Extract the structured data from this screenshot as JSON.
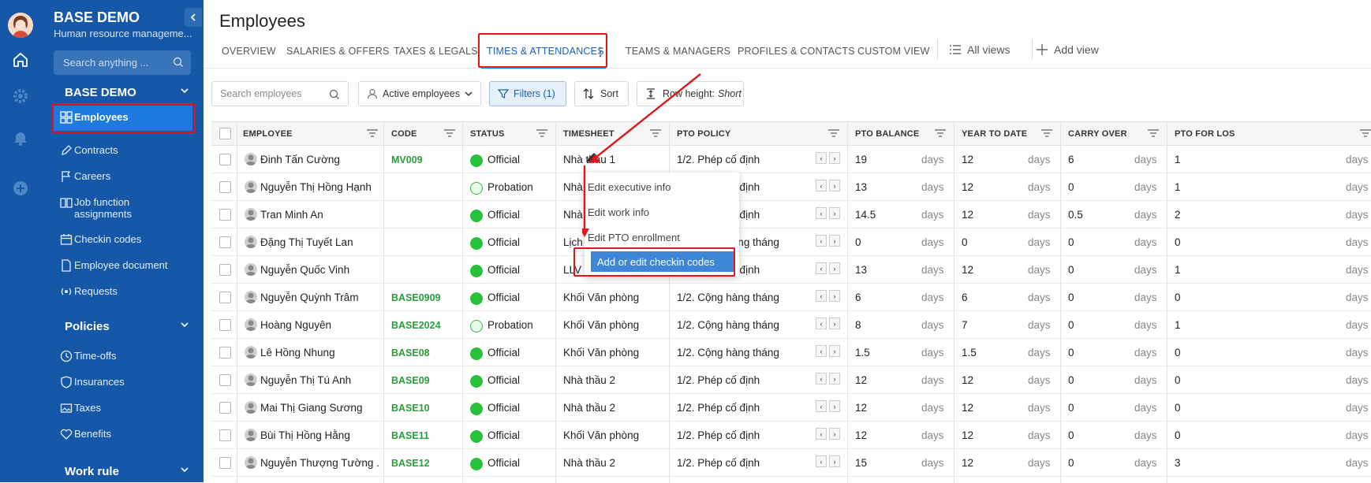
{
  "sidebar": {
    "brand": "BASE DEMO",
    "subtitle": "Human resource manageme...",
    "search_placeholder": "Search anything ...",
    "section1": "BASE DEMO",
    "items": [
      {
        "label": "Employees",
        "icon": "grid-icon"
      },
      {
        "label": "Contracts",
        "icon": "pen-icon"
      },
      {
        "label": "Careers",
        "icon": "flag-icon"
      },
      {
        "label": "Job function assignments",
        "icon": "book-icon"
      },
      {
        "label": "Checkin codes",
        "icon": "calendar-icon"
      },
      {
        "label": "Employee document",
        "icon": "document-icon"
      },
      {
        "label": "Requests",
        "icon": "broadcast-icon"
      }
    ],
    "section2": "Policies",
    "policy_items": [
      {
        "label": "Time-offs",
        "icon": "clock-icon"
      },
      {
        "label": "Insurances",
        "icon": "shield-icon"
      },
      {
        "label": "Taxes",
        "icon": "image-icon"
      },
      {
        "label": "Benefits",
        "icon": "heart-icon"
      }
    ],
    "section3": "Work rule"
  },
  "page": {
    "title": "Employees"
  },
  "tabs": [
    "OVERVIEW",
    "SALARIES & OFFERS",
    "TAXES & LEGALS",
    "TIMES & ATTENDANCES",
    "TEAMS & MANAGERS",
    "PROFILES & CONTACTS",
    "CUSTOM VIEW"
  ],
  "views": {
    "all": "All views",
    "add": "Add view"
  },
  "toolbar": {
    "search_placeholder": "Search employees",
    "active": "Active employees",
    "filters": "Filters (1)",
    "sort": "Sort",
    "row_height_label": "Row height:",
    "row_height_value": "Short"
  },
  "columns": [
    "EMPLOYEE",
    "CODE",
    "STATUS",
    "TIMESHEET",
    "PTO POLICY",
    "PTO BALANCE",
    "YEAR TO DATE",
    "CARRY OVER",
    "PTO FOR LOS"
  ],
  "unit": "days",
  "rows": [
    {
      "name": "Đinh Tấn Cường",
      "code": "MV009",
      "status": "Official",
      "timesheet": "Nhà thầu 1",
      "policy": "1/2. Phép cố định",
      "balance": "19",
      "ytd": "12",
      "carry": "6",
      "los": "1"
    },
    {
      "name": "Nguyễn Thị Hồng Hạnh",
      "code": "",
      "status": "Probation",
      "timesheet": "Nhà thầu 1",
      "policy": "1/2. Phép cố định",
      "balance": "13",
      "ytd": "12",
      "carry": "0",
      "los": "1"
    },
    {
      "name": "Tran Minh An",
      "code": "",
      "status": "Official",
      "timesheet": "Nhà thầu 1",
      "policy": "1/2. Phép cố định",
      "balance": "14.5",
      "ytd": "12",
      "carry": "0.5",
      "los": "2"
    },
    {
      "name": "Đặng Thị Tuyết Lan",
      "code": "",
      "status": "Official",
      "timesheet": "Lịch BP Lễ tân",
      "policy": "1/2. Cộng hàng tháng",
      "balance": "0",
      "ytd": "0",
      "carry": "0",
      "los": "0"
    },
    {
      "name": "Nguyễn Quốc Vinh",
      "code": "",
      "status": "Official",
      "timesheet": "LLV Văn phòng",
      "policy": "1/2. Phép cố định",
      "balance": "13",
      "ytd": "12",
      "carry": "0",
      "los": "1"
    },
    {
      "name": "Nguyễn Quỳnh Trâm",
      "code": "BASE0909",
      "status": "Official",
      "timesheet": "Khối Văn phòng",
      "policy": "1/2. Cộng hàng tháng",
      "balance": "6",
      "ytd": "6",
      "carry": "0",
      "los": "0"
    },
    {
      "name": "Hoàng Nguyên",
      "code": "BASE2024",
      "status": "Probation",
      "timesheet": "Khối Văn phòng",
      "policy": "1/2. Cộng hàng tháng",
      "balance": "8",
      "ytd": "7",
      "carry": "0",
      "los": "1"
    },
    {
      "name": "Lê Hồng Nhung",
      "code": "BASE08",
      "status": "Official",
      "timesheet": "Khối Văn phòng",
      "policy": "1/2. Cộng hàng tháng",
      "balance": "1.5",
      "ytd": "1.5",
      "carry": "0",
      "los": "0"
    },
    {
      "name": "Nguyễn Thị Tú Anh",
      "code": "BASE09",
      "status": "Official",
      "timesheet": "Nhà thầu 2",
      "policy": "1/2. Phép cố định",
      "balance": "12",
      "ytd": "12",
      "carry": "0",
      "los": "0"
    },
    {
      "name": "Mai Thị Giang Sương",
      "code": "BASE10",
      "status": "Official",
      "timesheet": "Nhà thầu 2",
      "policy": "1/2. Phép cố định",
      "balance": "12",
      "ytd": "12",
      "carry": "0",
      "los": "0"
    },
    {
      "name": "Bùi Thị Hồng Hằng",
      "code": "BASE11",
      "status": "Official",
      "timesheet": "Khối Văn phòng",
      "policy": "1/2. Phép cố định",
      "balance": "12",
      "ytd": "12",
      "carry": "0",
      "los": "0"
    },
    {
      "name": "Nguyễn Thượng Tường ...",
      "code": "BASE12",
      "status": "Official",
      "timesheet": "Nhà thầu 2",
      "policy": "1/2. Phép cố định",
      "balance": "15",
      "ytd": "12",
      "carry": "0",
      "los": "3"
    }
  ],
  "menu": [
    "Edit executive info",
    "Edit work info",
    "Edit PTO enrollment",
    "Add or edit checkin codes"
  ],
  "colors": {
    "sidebar": "#1558a7",
    "active": "#1f7ae0",
    "highlight": "#e0161d",
    "official": "#27c13a"
  }
}
